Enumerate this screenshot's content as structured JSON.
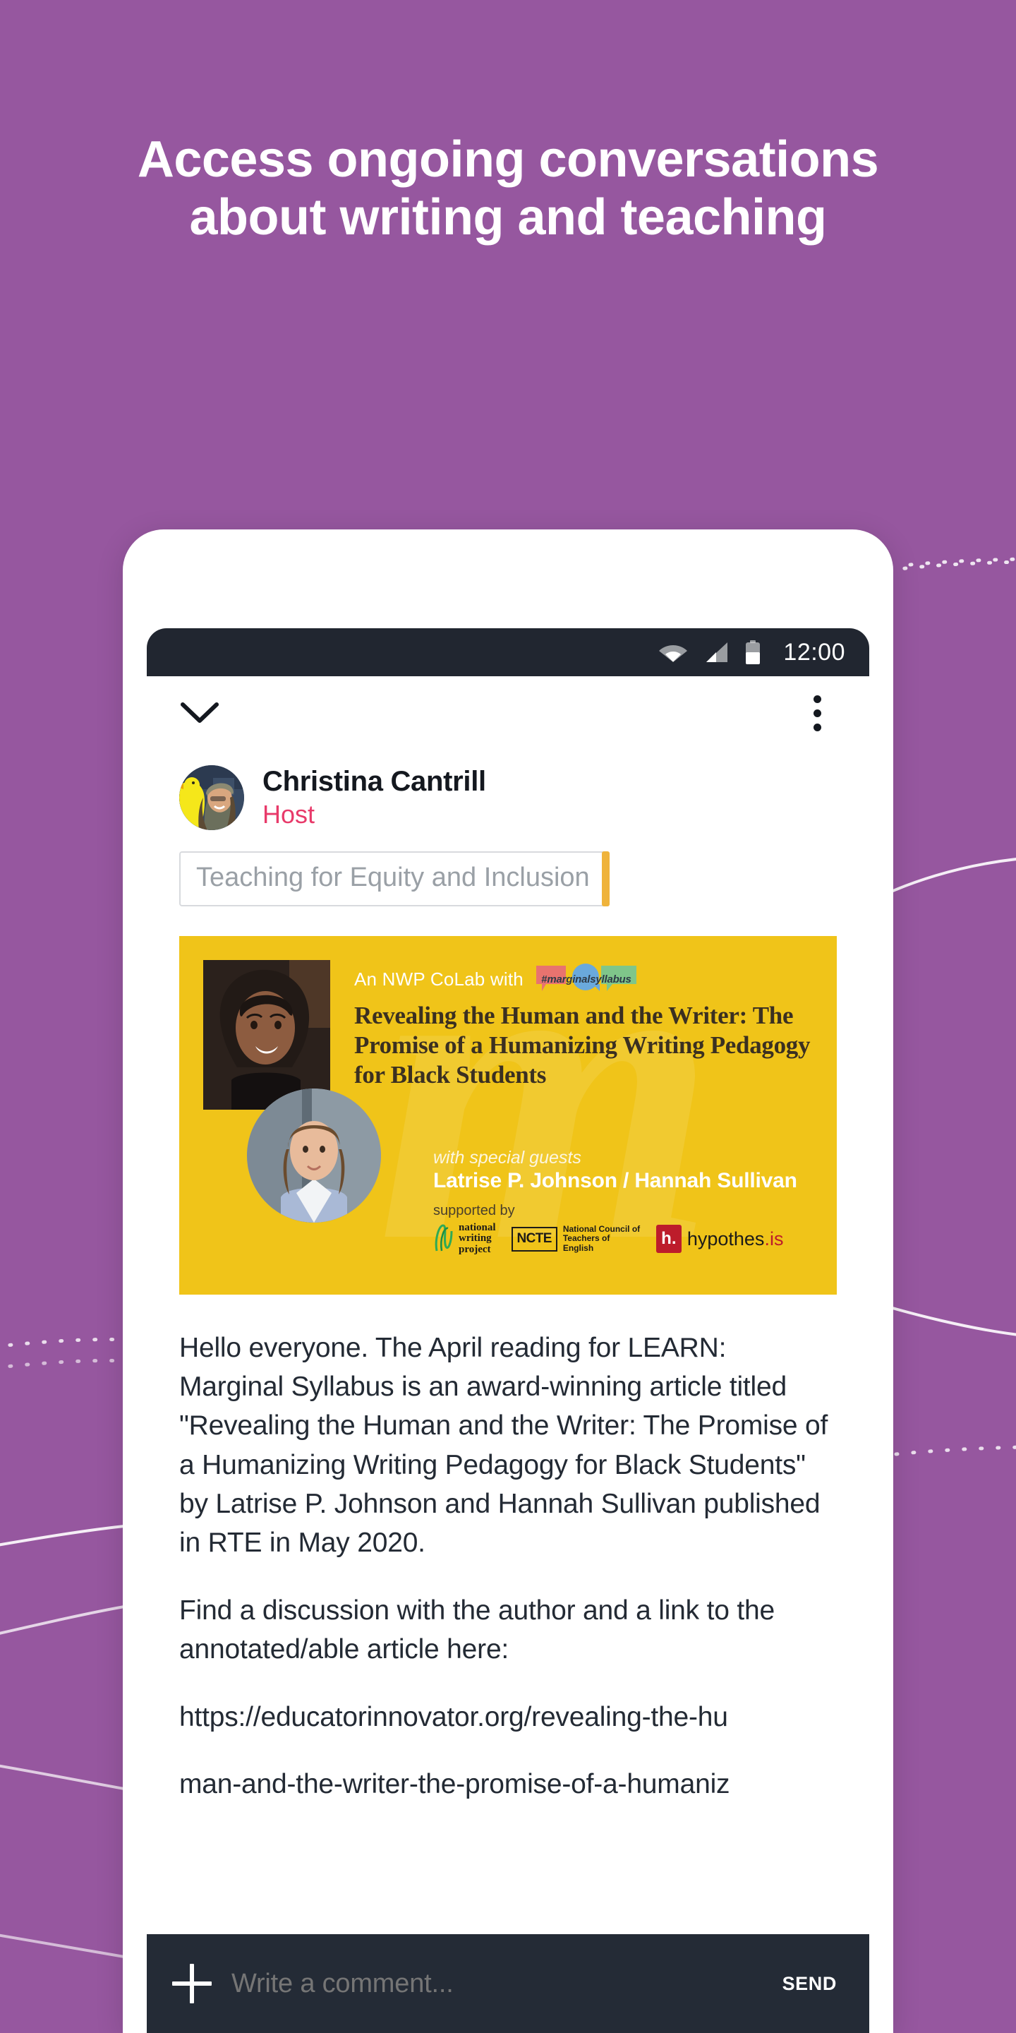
{
  "promo": {
    "headline": "Access ongoing conversations about writing and teaching",
    "background_color": "#96579f",
    "headline_color": "#ffffff"
  },
  "phone": {
    "status_bar": {
      "wifi_icon": "wifi-icon",
      "signal_icon": "cellular-signal-icon",
      "battery_icon": "battery-icon",
      "time": "12:00",
      "background_color": "#212630"
    },
    "header": {
      "collapse_icon": "chevron-down-icon",
      "overflow_icon": "kebab-menu-icon"
    },
    "post": {
      "author": {
        "name": "Christina Cantrill",
        "role": "Host",
        "role_color": "#e83a6a",
        "avatar_icon": "user-avatar"
      },
      "topic": {
        "label": "Teaching for Equity and Inclusion",
        "accent_color": "#efb33b"
      },
      "promo_image": {
        "background_color": "#f0c419",
        "eyebrow": "An NWP CoLab with",
        "logo_tag": "#marginalsyllabus",
        "title": "Revealing the Human and the Writer: The Promise of a Humanizing Writing Pedagogy for Black Students",
        "guests_label": "with special guests",
        "guests": "Latrise P. Johnson / Hannah Sullivan",
        "supported_by_label": "supported by",
        "sponsors": [
          {
            "name": "national writing project",
            "line1": "national",
            "line2": "writing",
            "line3": "project"
          },
          {
            "name": "NCTE",
            "abbr": "NCTE",
            "sub": "National Council of Teachers of English"
          },
          {
            "name": "hypothes.is",
            "mark": "h.",
            "text": "hypothes",
            "dot": ".is"
          }
        ],
        "watermark": "m"
      },
      "paragraphs": [
        "Hello everyone. The April reading for LEARN: Marginal Syllabus is an award-winning article titled \"Revealing the Human and the Writer: The Promise of a Humanizing Writing Pedagogy for Black Students\" by Latrise P. Johnson and Hannah Sullivan published in RTE in May 2020.",
        "Find a discussion with the author and a link to the annotated/able article here:"
      ],
      "url_line_1": "https://educatorinnovator.org/revealing-the-hu",
      "url_line_2": "man-and-the-writer-the-promise-of-a-humaniz"
    },
    "comment_bar": {
      "add_icon": "plus-icon",
      "placeholder": "Write a comment...",
      "send_label": "SEND",
      "background_color": "#242b36"
    }
  }
}
